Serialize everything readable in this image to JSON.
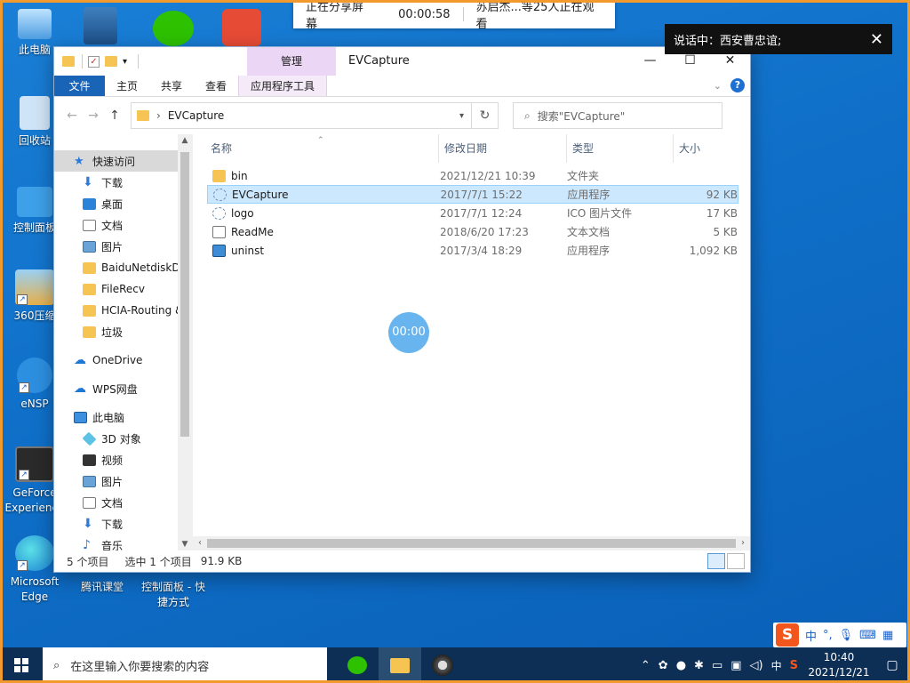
{
  "desktop": {
    "icons": [
      {
        "label": "此电脑"
      },
      {
        "label": "回收站"
      },
      {
        "label": "控制面板"
      },
      {
        "label": "360压缩"
      },
      {
        "label": "eNSP"
      },
      {
        "label": "GeForce Experience"
      },
      {
        "label": "Microsoft Edge"
      },
      {
        "label": "腾讯课堂"
      },
      {
        "label": "控制面板 - 快捷方式"
      }
    ]
  },
  "share_banner": {
    "status": "正在分享屏幕",
    "timer": "00:00:58",
    "viewers": "苏启杰...等25人正在观看"
  },
  "speaking_toast": {
    "text": "说话中：西安曹忠谊;",
    "close": "✕"
  },
  "explorer": {
    "manage_tab": "管理",
    "title": "EVCapture",
    "controls": {
      "minimize": "—",
      "maximize": "☐",
      "close": "✕"
    },
    "ribbon_tabs": [
      "文件",
      "主页",
      "共享",
      "查看",
      "应用程序工具"
    ],
    "address": "EVCapture",
    "search_placeholder": "搜索\"EVCapture\"",
    "nav_items": [
      {
        "label": "快速访问"
      },
      {
        "label": "下载"
      },
      {
        "label": "桌面"
      },
      {
        "label": "文档"
      },
      {
        "label": "图片"
      },
      {
        "label": "BaiduNetdiskD"
      },
      {
        "label": "FileRecv"
      },
      {
        "label": "HCIA-Routing &"
      },
      {
        "label": "垃圾"
      },
      {
        "label": "OneDrive"
      },
      {
        "label": "WPS网盘"
      },
      {
        "label": "此电脑"
      },
      {
        "label": "3D 对象"
      },
      {
        "label": "视频"
      },
      {
        "label": "图片"
      },
      {
        "label": "文档"
      },
      {
        "label": "下载"
      },
      {
        "label": "音乐"
      }
    ],
    "columns": {
      "name": "名称",
      "date": "修改日期",
      "type": "类型",
      "size": "大小"
    },
    "files": [
      {
        "name": "bin",
        "date": "2021/12/21 10:39",
        "type": "文件夹",
        "size": ""
      },
      {
        "name": "EVCapture",
        "date": "2017/7/1 15:22",
        "type": "应用程序",
        "size": "92 KB"
      },
      {
        "name": "logo",
        "date": "2017/7/1 12:24",
        "type": "ICO 图片文件",
        "size": "17 KB"
      },
      {
        "name": "ReadMe",
        "date": "2018/6/20 17:23",
        "type": "文本文档",
        "size": "5 KB"
      },
      {
        "name": "uninst",
        "date": "2017/3/4 18:29",
        "type": "应用程序",
        "size": "1,092 KB"
      }
    ],
    "status": {
      "count": "5 个项目",
      "selected": "选中 1 个项目",
      "size": "91.9 KB"
    }
  },
  "overlay_timer": "00:00",
  "taskbar": {
    "search_placeholder": "在这里输入你要搜索的内容",
    "ime_lang": "中",
    "time": "10:40",
    "date": "2021/12/21"
  },
  "ime_bar": {
    "logo": "S",
    "lang": "中",
    "punct": "°,"
  },
  "colors": {
    "desktop": "#0f6fc8",
    "share_border": "#f29a2e",
    "selection": "#cce8ff",
    "file_tab": "#1a64b8",
    "manage_tab": "#ecd6f5"
  }
}
